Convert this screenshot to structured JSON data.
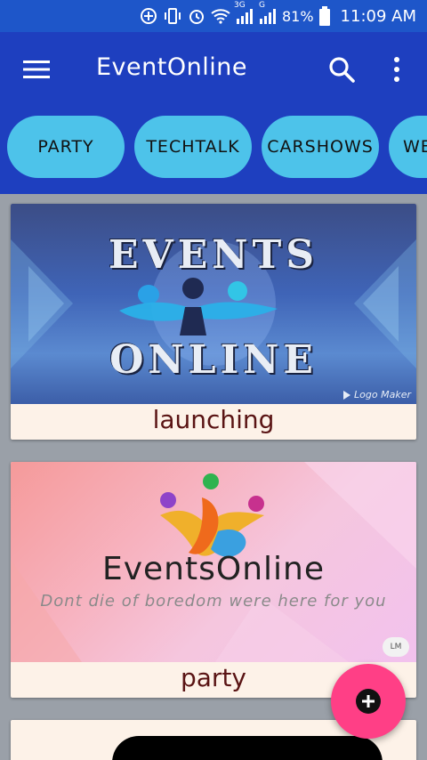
{
  "status": {
    "battery": "81%",
    "time": "11:09 AM",
    "net1": "3G",
    "net2": "G",
    "icons": [
      "sync-icon",
      "vibrate-icon",
      "alarm-icon",
      "wifi-icon",
      "signal-3g-icon",
      "signal-g-icon",
      "battery-icon"
    ]
  },
  "appbar": {
    "title": "EventOnline",
    "icons": [
      "menu-icon",
      "search-icon",
      "more-vert-icon"
    ]
  },
  "tabs": [
    {
      "label": "PARTY"
    },
    {
      "label": "TECHTALK"
    },
    {
      "label": "CARSHOWS"
    },
    {
      "label": "WE"
    }
  ],
  "cards": [
    {
      "caption": "launching",
      "image": {
        "headline1": "EVENTS",
        "headline2": "ONLINE",
        "watermark": "Logo Maker"
      }
    },
    {
      "caption": "party",
      "image": {
        "brand": "EventsOnline",
        "tagline": "Dont die of boredom were here for you",
        "badge": "LM"
      }
    }
  ],
  "fab": {
    "icon": "add-icon"
  },
  "colors": {
    "statusbar": "#1e56c9",
    "appbar": "#1e3fbf",
    "chip": "#4dc3ea",
    "fab": "#ff3f86",
    "caption": "#5a1414"
  }
}
